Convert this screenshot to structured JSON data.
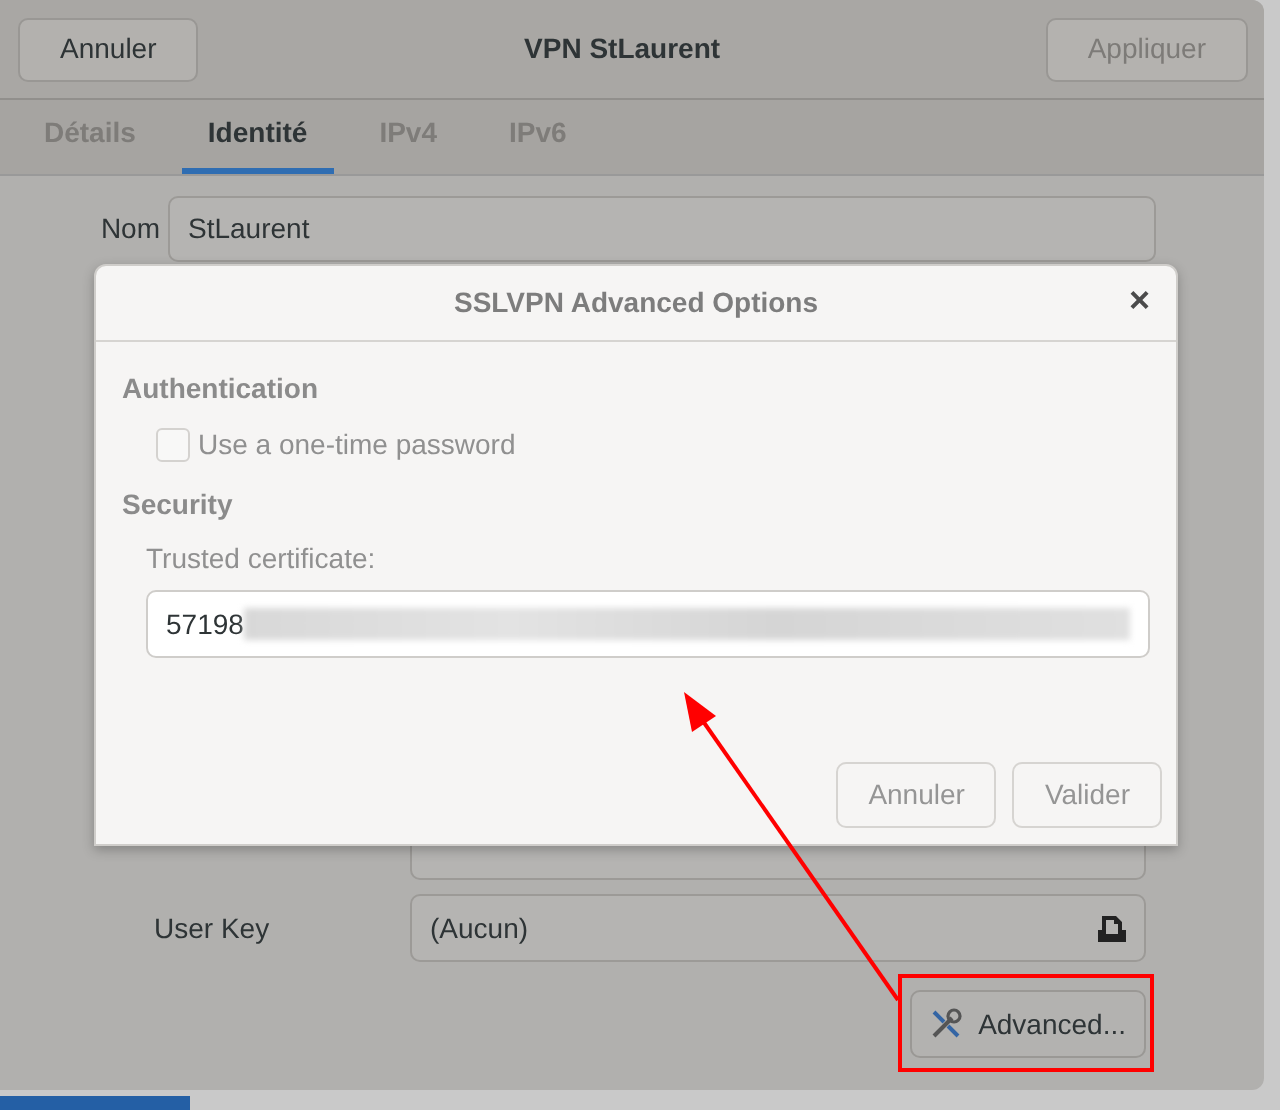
{
  "window": {
    "title": "VPN StLaurent",
    "cancel_button": "Annuler",
    "apply_button": {
      "label": "Appliquer",
      "disabled": true
    }
  },
  "tabs": [
    {
      "label": "Détails",
      "selected": false
    },
    {
      "label": "Identité",
      "selected": true
    },
    {
      "label": "IPv4",
      "selected": false
    },
    {
      "label": "IPv6",
      "selected": false
    }
  ],
  "name_field": {
    "label": "Nom",
    "value": "StLaurent"
  },
  "file_rows": [
    {
      "kind": "covered"
    },
    {
      "kind": "visible",
      "label": "User Key",
      "value": "(Aucun)"
    }
  ],
  "advanced_button": "Advanced...",
  "dialog": {
    "title": "SSLVPN Advanced Options",
    "close": "×",
    "sections": [
      {
        "heading": "Authentication",
        "items": [
          {
            "kind": "checkbox",
            "label": "Use a one-time password",
            "checked": false,
            "disabled": true
          }
        ]
      },
      {
        "heading": "Security",
        "items": [
          {
            "kind": "entry",
            "label": "Trusted certificate:",
            "value": "57198"
          }
        ]
      }
    ],
    "buttons": [
      {
        "label": "Annuler",
        "disabled": true
      },
      {
        "label": "Valider",
        "disabled": true
      }
    ]
  }
}
